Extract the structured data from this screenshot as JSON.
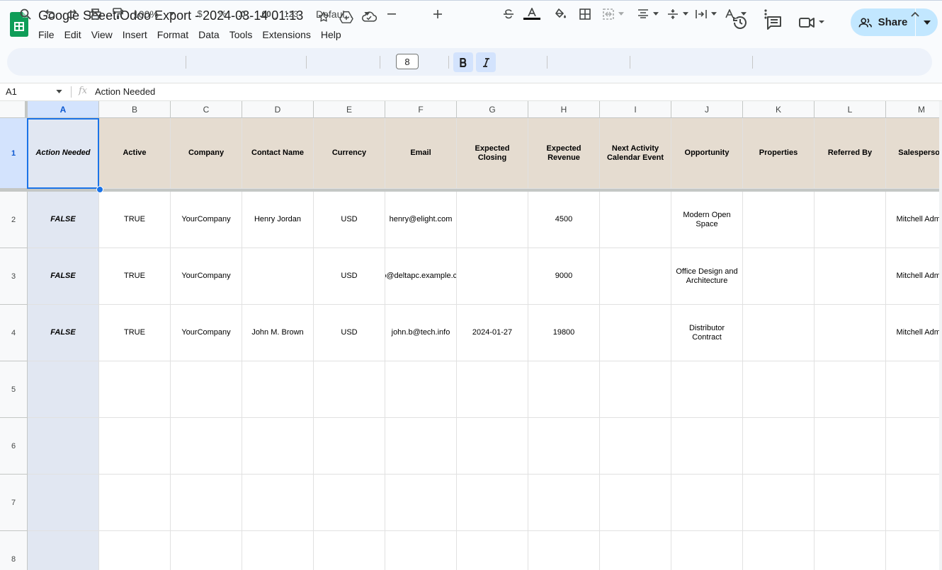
{
  "document": {
    "title": "Google Sheet Odoo Export - 2024-03-14 01:13"
  },
  "menu": [
    "File",
    "Edit",
    "View",
    "Insert",
    "Format",
    "Data",
    "Tools",
    "Extensions",
    "Help"
  ],
  "share": {
    "label": "Share"
  },
  "toolbar": {
    "zoom": "100%",
    "currency": "$",
    "percent": "%",
    "dec_decrease": ".0",
    "dec_increase": ".00",
    "number_format": "123",
    "font": "Defaul...",
    "font_size": "8"
  },
  "formula_bar": {
    "cell_ref": "A1",
    "fx": "fx",
    "value": "Action Needed"
  },
  "columns": [
    "A",
    "B",
    "C",
    "D",
    "E",
    "F",
    "G",
    "H",
    "I",
    "J",
    "K",
    "L",
    "M"
  ],
  "rows": [
    "1",
    "2",
    "3",
    "4",
    "5",
    "6",
    "7",
    "8"
  ],
  "sheet": {
    "headers": [
      "Action Needed",
      "Active",
      "Company",
      "Contact Name",
      "Currency",
      "Email",
      "Expected Closing",
      "Expected Revenue",
      "Next Activity Calendar Event",
      "Opportunity",
      "Properties",
      "Referred By",
      "Salesperson"
    ],
    "data": [
      [
        "FALSE",
        "TRUE",
        "YourCompany",
        "Henry Jordan",
        "USD",
        "henry@elight.com",
        "",
        "4500",
        "",
        "Modern Open Space",
        "",
        "",
        "Mitchell Admin"
      ],
      [
        "FALSE",
        "TRUE",
        "YourCompany",
        "",
        "USD",
        "info@deltapc.example.com",
        "",
        "9000",
        "",
        "Office Design and Architecture",
        "",
        "",
        "Mitchell Admin"
      ],
      [
        "FALSE",
        "TRUE",
        "YourCompany",
        "John M. Brown",
        "USD",
        "john.b@tech.info",
        "2024-01-27",
        "19800",
        "",
        "Distributor Contract",
        "",
        "",
        "Mitchell Admin"
      ],
      [
        "",
        "",
        "",
        "",
        "",
        "",
        "",
        "",
        "",
        "",
        "",
        "",
        ""
      ],
      [
        "",
        "",
        "",
        "",
        "",
        "",
        "",
        "",
        "",
        "",
        "",
        "",
        ""
      ],
      [
        "",
        "",
        "",
        "",
        "",
        "",
        "",
        "",
        "",
        "",
        "",
        "",
        ""
      ],
      [
        "",
        "",
        "",
        "",
        "",
        "",
        "",
        "",
        "",
        "",
        "",
        "",
        ""
      ]
    ]
  },
  "colors": {
    "header_fill": "#e5dcd0",
    "selected_column_fill": "#e1e7f2",
    "selection_border": "#1a73e8",
    "share_button": "#c2e7ff"
  }
}
